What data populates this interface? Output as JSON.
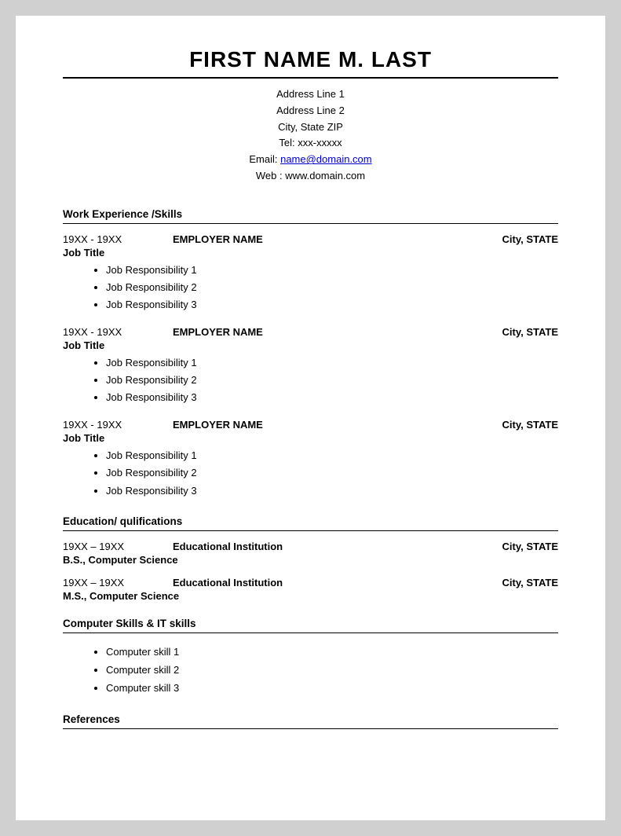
{
  "header": {
    "name": "FIRST NAME M. LAST",
    "address1": "Address Line 1",
    "address2": "Address Line 2",
    "city_state_zip": "City, State ZIP",
    "tel_label": "Tel: xxx-xxxxx",
    "email_label": "Email: ",
    "email_link_text": "name@domain.com",
    "email_link_href": "mailto:name@domain.com",
    "web_label": "Web : www.domain.com"
  },
  "sections": {
    "work_experience": {
      "label": "Work Experience /Skills",
      "jobs": [
        {
          "dates": "19XX - 19XX",
          "employer": "EMPLOYER NAME",
          "location": "City, STATE",
          "title": "Job Title",
          "responsibilities": [
            "Job Responsibility 1",
            "Job Responsibility 2",
            "Job Responsibility 3"
          ]
        },
        {
          "dates": "19XX - 19XX",
          "employer": "EMPLOYER NAME",
          "location": "City, STATE",
          "title": "Job Title",
          "responsibilities": [
            "Job Responsibility 1",
            "Job Responsibility 2",
            "Job Responsibility 3"
          ]
        },
        {
          "dates": "19XX - 19XX",
          "employer": "EMPLOYER NAME",
          "location": "City, STATE",
          "title": "Job Title",
          "responsibilities": [
            "Job Responsibility 1",
            "Job Responsibility 2",
            "Job Responsibility 3"
          ]
        }
      ]
    },
    "education": {
      "label": "Education/ qulifications",
      "entries": [
        {
          "dates": "19XX – 19XX",
          "institution": "Educational Institution",
          "location": "City, STATE",
          "degree": "B.S., Computer Science"
        },
        {
          "dates": "19XX – 19XX",
          "institution": "Educational Institution",
          "location": "City, STATE",
          "degree": "M.S., Computer Science"
        }
      ]
    },
    "computer_skills": {
      "label": "Computer Skills & IT skills",
      "skills": [
        "Computer skill 1",
        "Computer skill 2",
        "Computer skill 3"
      ]
    },
    "references": {
      "label": "References"
    }
  }
}
